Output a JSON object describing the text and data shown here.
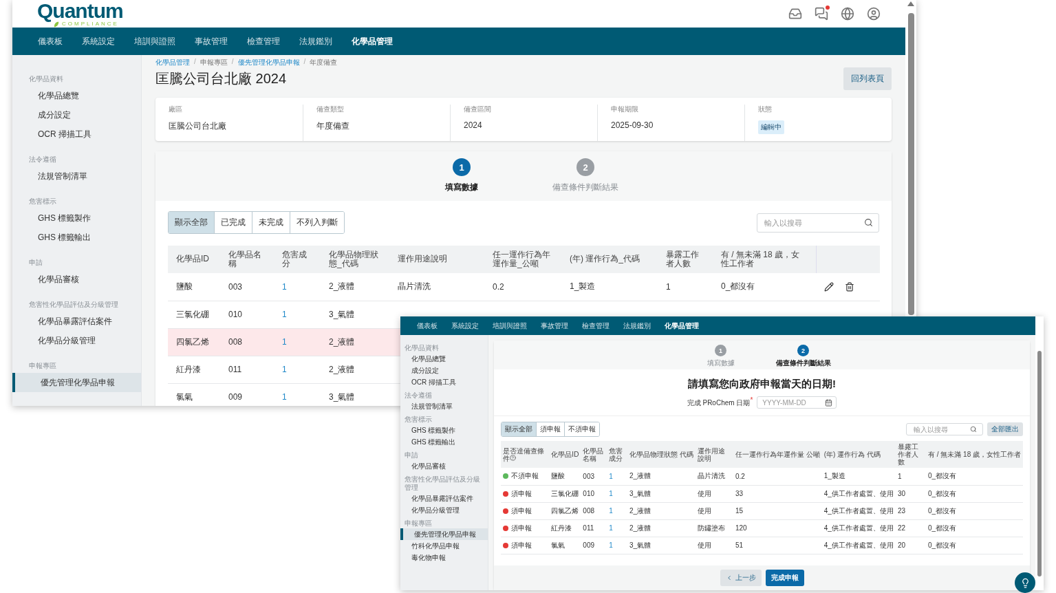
{
  "back_window": {
    "logo": {
      "name": "Quantum",
      "tagline": "COMPLIANCE"
    },
    "header": {
      "unread_messages": true
    },
    "nav": [
      {
        "label": "儀表板",
        "selected": false
      },
      {
        "label": "系統設定",
        "selected": false
      },
      {
        "label": "培訓與證照",
        "selected": false
      },
      {
        "label": "事故管理",
        "selected": false
      },
      {
        "label": "檢查管理",
        "selected": false
      },
      {
        "label": "法規鑑別",
        "selected": false
      },
      {
        "label": "化學品管理",
        "selected": true
      }
    ],
    "sidebar": [
      {
        "section": "化學品資料",
        "items": [
          {
            "label": "化學品總覽",
            "selected": false
          },
          {
            "label": "成分設定",
            "selected": false
          },
          {
            "label": "OCR 掃描工具",
            "selected": false
          }
        ]
      },
      {
        "section": "法令遵循",
        "items": [
          {
            "label": "法規管制清單",
            "selected": false
          }
        ]
      },
      {
        "section": "危害標示",
        "items": [
          {
            "label": "GHS 標籤製作",
            "selected": false
          },
          {
            "label": "GHS 標籤輸出",
            "selected": false
          }
        ]
      },
      {
        "section": "申請",
        "items": [
          {
            "label": "化學品審核",
            "selected": false
          }
        ]
      },
      {
        "section": "危害性化學品評估及分級管理",
        "items": [
          {
            "label": "化學品暴露評估案件",
            "selected": false
          },
          {
            "label": "化學品分級管理",
            "selected": false
          }
        ]
      },
      {
        "section": "申報專區",
        "items": [
          {
            "label": "優先管理化學品申報",
            "selected": true
          }
        ]
      }
    ],
    "breadcrumb": [
      {
        "label": "化學品管理",
        "kind": "link"
      },
      {
        "separator": "/",
        "label": "申報專區",
        "kind": "text"
      },
      {
        "separator": "/",
        "label": "優先管理化學品申報",
        "kind": "link"
      },
      {
        "separator": "/",
        "label": "年度備查",
        "kind": "text"
      }
    ],
    "title": "匡騰公司台北廠 2024",
    "back_button": "回列表頁",
    "info": [
      {
        "label": "廠區",
        "value": "匡騰公司台北廠",
        "kind": "text"
      },
      {
        "label": "備查類型",
        "value": "年度備查",
        "kind": "text"
      },
      {
        "label": "備查區間",
        "value": "2024",
        "kind": "text"
      },
      {
        "label": "申報期限",
        "value": "2025-09-30",
        "kind": "text"
      },
      {
        "label": "狀態",
        "value": "編輯中",
        "kind": "badge"
      }
    ],
    "steps": [
      {
        "number": "1",
        "label": "填寫數據",
        "active": true
      },
      {
        "number": "2",
        "label": "備查條件判斷結果",
        "active": false
      }
    ],
    "filters": [
      {
        "label": "顯示全部",
        "selected": true
      },
      {
        "label": "已完成",
        "selected": false
      },
      {
        "label": "未完成",
        "selected": false
      },
      {
        "label": "不列入判斷",
        "selected": false
      }
    ],
    "search": {
      "placeholder": "輸入以搜尋"
    },
    "table": {
      "columns": [
        "化學品ID",
        "化學品名稱",
        "危害成分",
        "化學品物理狀態_代碼",
        "運作用途說明",
        "任一運作行為年運作量_公噸",
        "(年) 運作行為_代碼",
        "暴露工作者人數",
        "有 / 無未滿 18 歲，女性工作者"
      ],
      "rows": [
        {
          "highlighted": false,
          "actions": true,
          "cells": [
            "鹽酸",
            "003",
            "1",
            "2_液體",
            "晶片清洗",
            "0.2",
            "1_製造",
            "1",
            "0_都沒有"
          ]
        },
        {
          "highlighted": false,
          "cells": [
            "三氯化硼",
            "010",
            "1",
            "3_氣體"
          ]
        },
        {
          "highlighted": true,
          "cells": [
            "四氯乙烯",
            "008",
            "1",
            "2_液體"
          ]
        },
        {
          "highlighted": false,
          "cells": [
            "紅丹漆",
            "011",
            "1",
            "2_液體"
          ]
        },
        {
          "highlighted": false,
          "cells": [
            "氯氣",
            "009",
            "1",
            "3_氣體"
          ]
        }
      ]
    }
  },
  "front_window": {
    "nav": [
      {
        "label": "儀表板",
        "selected": false
      },
      {
        "label": "系統設定",
        "selected": false
      },
      {
        "label": "培訓與證照",
        "selected": false
      },
      {
        "label": "事故管理",
        "selected": false
      },
      {
        "label": "檢查管理",
        "selected": false
      },
      {
        "label": "法規鑑別",
        "selected": false
      },
      {
        "label": "化學品管理",
        "selected": true
      }
    ],
    "sidebar": [
      {
        "section": "化學品資料",
        "items": [
          {
            "label": "化學品總覽",
            "selected": false
          },
          {
            "label": "成分設定",
            "selected": false
          },
          {
            "label": "OCR 掃描工具",
            "selected": false
          }
        ]
      },
      {
        "section": "法令遵循",
        "items": [
          {
            "label": "法規管制清單",
            "selected": false
          }
        ]
      },
      {
        "section": "危害標示",
        "items": [
          {
            "label": "GHS 標籤製作",
            "selected": false
          },
          {
            "label": "GHS 標籤輸出",
            "selected": false
          }
        ]
      },
      {
        "section": "申請",
        "items": [
          {
            "label": "化學品審核",
            "selected": false
          }
        ]
      },
      {
        "section": "危害性化學品評估及分級管理",
        "items": [
          {
            "label": "化學品暴露評估案件",
            "selected": false
          },
          {
            "label": "化學品分級管理",
            "selected": false
          }
        ]
      },
      {
        "section": "申報專區",
        "items": [
          {
            "label": "優先管理化學品申報",
            "selected": true
          },
          {
            "label": "竹科化學品申報",
            "selected": false
          },
          {
            "label": "毒化物申報",
            "selected": false
          }
        ]
      }
    ],
    "steps": [
      {
        "number": "1",
        "label": "填寫數據",
        "active": false
      },
      {
        "number": "2",
        "label": "備查條件判斷結果",
        "active": true
      }
    ],
    "heading": "請填寫您向政府申報當天的日期!",
    "date_field": {
      "label": "完成 PRoChem 日期",
      "required_mark": "*",
      "placeholder": "YYYY-MM-DD"
    },
    "filters": [
      {
        "label": "顯示全部",
        "selected": true
      },
      {
        "label": "須申報",
        "selected": false
      },
      {
        "label": "不須申報",
        "selected": false
      }
    ],
    "search": {
      "placeholder": "輸入以搜尋"
    },
    "export_button": "全部匯出",
    "table": {
      "columns": [
        "是否達備查條件",
        "化學品ID",
        "化學品名稱",
        "危害成分",
        "化學品物理狀態 代碼",
        "運作用途說明",
        "任一運作行為年運作量 公噸",
        "(年) 運作行為 代碼",
        "暴露工作者人數",
        "有 / 無未滿 18 歲，女性工作者"
      ],
      "rows": [
        {
          "color": "#5cb85c",
          "cells": [
            "不須申報",
            "鹽酸",
            "003",
            "1",
            "2_液體",
            "晶片清洗",
            "0.2",
            "1_製造",
            "1",
            "0_都沒有"
          ]
        },
        {
          "color": "#e53935",
          "cells": [
            "須申報",
            "三氯化硼",
            "010",
            "1",
            "3_氣體",
            "使用",
            "33",
            "4_供工作者處置、使用",
            "30",
            "0_都沒有"
          ]
        },
        {
          "color": "#e53935",
          "cells": [
            "須申報",
            "四氯乙烯",
            "008",
            "1",
            "2_液體",
            "使用",
            "15",
            "4_供工作者處置、使用",
            "23",
            "0_都沒有"
          ]
        },
        {
          "color": "#e53935",
          "cells": [
            "須申報",
            "紅丹漆",
            "011",
            "1",
            "2_液體",
            "防鏽塗布",
            "120",
            "4_供工作者處置、使用",
            "22",
            "0_都沒有"
          ]
        },
        {
          "color": "#e53935",
          "cells": [
            "須申報",
            "氯氣",
            "009",
            "1",
            "3_氣體",
            "使用",
            "51",
            "4_供工作者處置、使用",
            "20",
            "0_都沒有"
          ]
        }
      ]
    },
    "back_step_button": "上一步",
    "submit_button": "完成申報"
  }
}
